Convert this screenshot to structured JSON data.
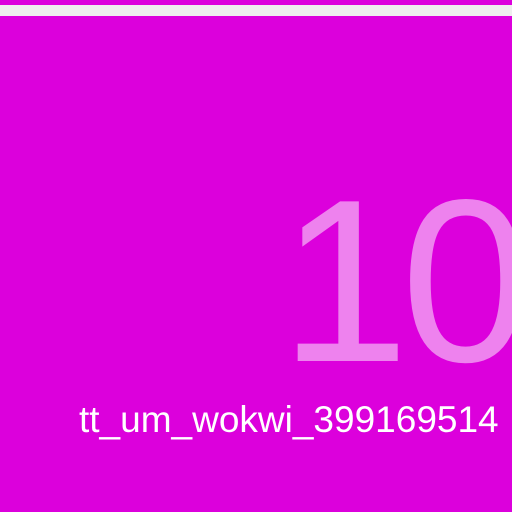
{
  "tile": {
    "number": "10",
    "label": "tt_um_wokwi_399169514",
    "background_color": "#dc00dc",
    "number_color": "#ee82ee",
    "label_color": "#ffffff"
  },
  "header": {
    "bar_color": "#eeeeee"
  }
}
